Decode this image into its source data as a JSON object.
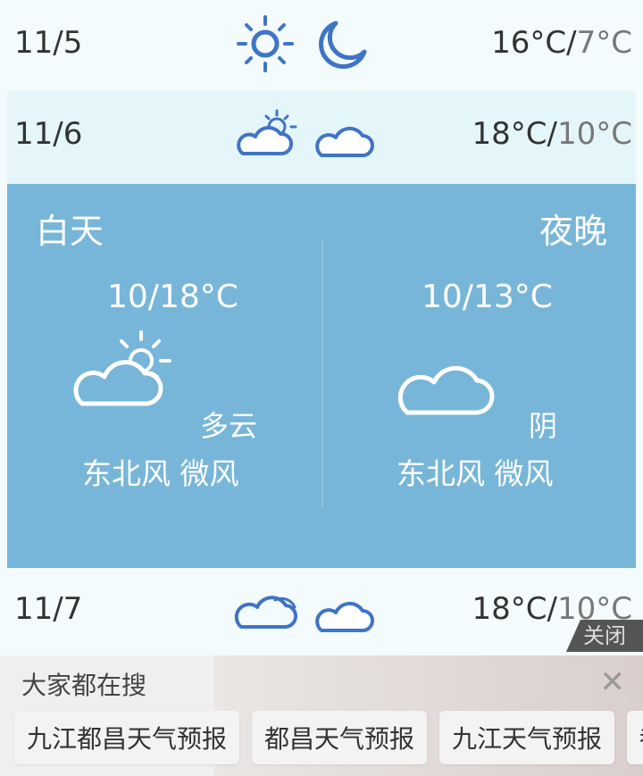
{
  "forecast": [
    {
      "date": "11/5",
      "high": "16°C",
      "sep": "/",
      "low": "7°C",
      "day_icon": "sun-icon",
      "night_icon": "moon-icon"
    },
    {
      "date": "11/6",
      "high": "18°C",
      "sep": "/",
      "low": "10°C",
      "day_icon": "partly-cloudy-day-icon",
      "night_icon": "partly-cloudy-night-icon"
    },
    {
      "date": "11/7",
      "high": "18°C",
      "sep": "/",
      "low": "10°C",
      "day_icon": "cloudy-icon",
      "night_icon": "partly-cloudy-night-icon"
    }
  ],
  "detail": {
    "day_label": "白天",
    "night_label": "夜晚",
    "day_temp": "10/18°C",
    "night_temp": "10/13°C",
    "day_condition": "多云",
    "night_condition": "阴",
    "day_wind": "东北风 微风",
    "night_wind": "东北风 微风",
    "day_icon": "partly-cloudy-day-icon",
    "night_icon": "partly-cloudy-night-icon"
  },
  "ad": {
    "close_label": "关闭",
    "title": "大家都在搜",
    "close_icon": "close-icon",
    "chips": [
      "九江都昌天气预报",
      "都昌天气预报",
      "九江天气预报",
      "都"
    ]
  },
  "colors": {
    "icon_blue": "#3f74c6",
    "detail_bg": "#77b6d9",
    "row_highlight": "#e4f6f9"
  }
}
